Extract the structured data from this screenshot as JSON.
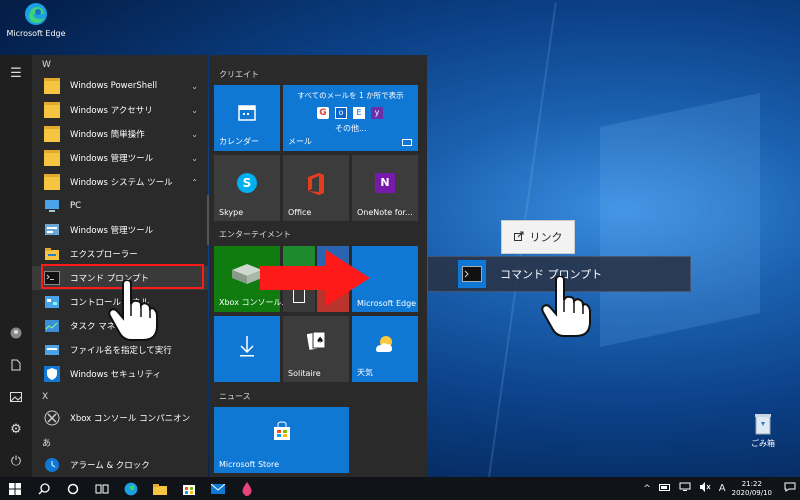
{
  "desktop": {
    "edge_icon_label": "Microsoft Edge",
    "recycle_bin_label": "ごみ箱"
  },
  "start_menu": {
    "app_list": {
      "letters": {
        "w": "W",
        "x": "X",
        "a": "あ"
      },
      "items": [
        {
          "label": "Windows PowerShell",
          "icon": "folder-icon",
          "expandable": true,
          "expanded": false
        },
        {
          "label": "Windows アクセサリ",
          "icon": "folder-icon",
          "expandable": true,
          "expanded": false
        },
        {
          "label": "Windows 簡単操作",
          "icon": "folder-icon",
          "expandable": true,
          "expanded": false
        },
        {
          "label": "Windows 管理ツール",
          "icon": "folder-icon",
          "expandable": true,
          "expanded": false
        },
        {
          "label": "Windows システム ツール",
          "icon": "folder-icon",
          "expandable": true,
          "expanded": true
        },
        {
          "label": "PC",
          "icon": "pc-icon"
        },
        {
          "label": "Windows 管理ツール",
          "icon": "admin-tools-icon"
        },
        {
          "label": "エクスプローラー",
          "icon": "file-explorer-icon"
        },
        {
          "label": "コマンド プロンプト",
          "icon": "command-prompt-icon",
          "highlighted": true
        },
        {
          "label": "コントロール パネル",
          "icon": "control-panel-icon"
        },
        {
          "label": "タスク マネージャー",
          "icon": "task-manager-icon"
        },
        {
          "label": "ファイル名を指定して実行",
          "icon": "run-icon"
        },
        {
          "label": "Windows セキュリティ",
          "icon": "shield-icon"
        },
        {
          "label": "Xbox コンソール コンパニオン",
          "icon": "xbox-icon"
        },
        {
          "label": "アラーム & クロック",
          "icon": "alarm-clock-icon"
        }
      ]
    },
    "tiles": {
      "group_create": "クリエイト",
      "group_entertainment": "エンターテイメント",
      "group_news": "ニュース",
      "calendar": "カレンダー",
      "mail": "メール",
      "mail_top": "すべてのメールを 1 か所で表示",
      "mail_more": "その他...",
      "skype": "Skype",
      "office": "Office",
      "onenote": "OneNote for...",
      "xbox": "Xbox コンソール...",
      "edge": "Microsoft Edge",
      "solitaire": "Solitaire",
      "weather": "天気",
      "store": "Microsoft Store"
    }
  },
  "drag": {
    "ghost_label": "コマンド プロンプト",
    "tooltip": "リンク"
  },
  "taskbar": {
    "input_indicator": "A",
    "time": "21:22",
    "date": "2020/09/10"
  },
  "colors": {
    "accent": "#0f78d4",
    "highlight_border": "#ff1a1a",
    "arrow": "#ff1a1a"
  }
}
